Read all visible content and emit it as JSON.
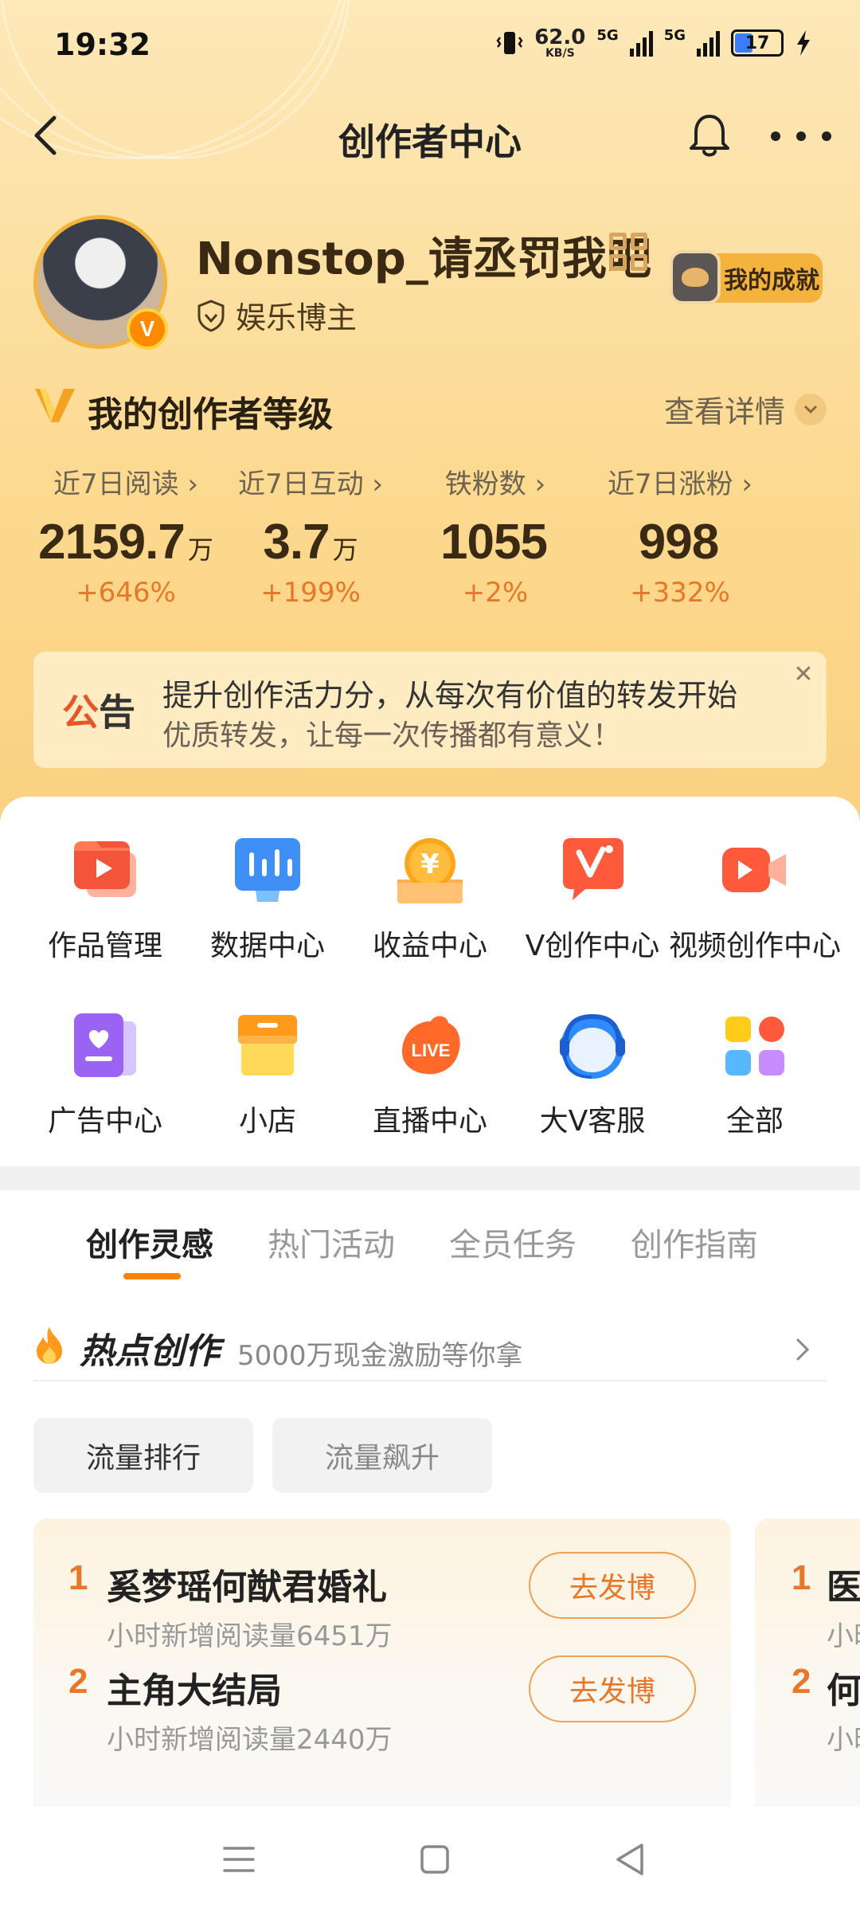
{
  "status_bar": {
    "time": "19:32",
    "net_speed_value": "62.0",
    "net_speed_unit": "KB/S",
    "sim1_label": "5G",
    "sim2_label": "5G",
    "battery_level": "17"
  },
  "header": {
    "title": "创作者中心"
  },
  "profile": {
    "username": "Nonstop_请丞罚我吧",
    "verified_badge": "V",
    "role": "娱乐博主",
    "achievement_label": "我的成就"
  },
  "level": {
    "title": "我的创作者等级",
    "detail_label": "查看详情"
  },
  "stats": [
    {
      "label": "近7日阅读",
      "value": "2159.7",
      "unit": "万",
      "change": "+646%"
    },
    {
      "label": "近7日互动",
      "value": "3.7",
      "unit": "万",
      "change": "+199%"
    },
    {
      "label": "铁粉数",
      "value": "1055",
      "unit": "",
      "change": "+2%"
    },
    {
      "label": "近7日涨粉",
      "value": "998",
      "unit": "",
      "change": "+332%"
    }
  ],
  "notice": {
    "tag_first": "公",
    "tag_second": "告",
    "line1": "提升创作活力分，从每次有价值的转发开始",
    "line2": "优质转发，让每一次传播都有意义！",
    "close_glyph": "✕"
  },
  "tools": [
    {
      "label": "作品管理",
      "icon": "works-manage-icon"
    },
    {
      "label": "数据中心",
      "icon": "data-center-icon"
    },
    {
      "label": "收益中心",
      "icon": "income-center-icon"
    },
    {
      "label": "V创作中心",
      "icon": "v-creation-icon"
    },
    {
      "label": "视频创作中心",
      "icon": "video-creation-icon"
    },
    {
      "label": "广告中心",
      "icon": "ad-center-icon"
    },
    {
      "label": "小店",
      "icon": "shop-icon"
    },
    {
      "label": "直播中心",
      "icon": "live-center-icon"
    },
    {
      "label": "大V客服",
      "icon": "customer-service-icon"
    },
    {
      "label": "全部",
      "icon": "all-apps-icon"
    }
  ],
  "tabs": [
    "创作灵感",
    "热门活动",
    "全员任务",
    "创作指南"
  ],
  "hot": {
    "title": "热点创作",
    "subtitle": "5000万现金激励等你拿"
  },
  "chips": [
    "流量排行",
    "流量飙升"
  ],
  "rank_list": [
    {
      "rank": "1",
      "title": "奚梦瑶何猷君婚礼",
      "sub": "小时新增阅读量6451万",
      "button": "去发博"
    },
    {
      "rank": "2",
      "title": "主角大结局",
      "sub": "小时新增阅读量2440万",
      "button": "去发博"
    }
  ],
  "rank_list2": [
    {
      "rank": "1",
      "title": "医",
      "sub": "小时"
    },
    {
      "rank": "2",
      "title": "何",
      "sub": "小时"
    }
  ],
  "live_icon_text": "LIVE",
  "income_icon_text": "¥",
  "colors": {
    "accent_orange": "#e8772a",
    "tab_underline": "#ff8200",
    "header_bg": "#fcd98f"
  }
}
